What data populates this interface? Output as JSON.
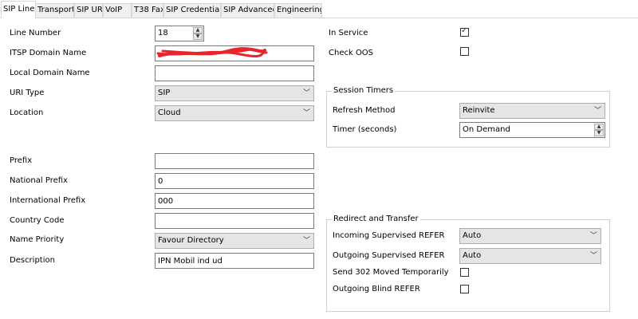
{
  "tabs": [
    {
      "label": "SIP Line",
      "active": true
    },
    {
      "label": "Transport"
    },
    {
      "label": "SIP URI"
    },
    {
      "label": "VoIP"
    },
    {
      "label": "T38 Fax"
    },
    {
      "label": "SIP Credentials"
    },
    {
      "label": "SIP Advanced"
    },
    {
      "label": "Engineering"
    }
  ],
  "left": {
    "line_number": {
      "label": "Line Number",
      "value": "18"
    },
    "itsp_domain": {
      "label": "ITSP Domain Name",
      "value": ""
    },
    "local_domain": {
      "label": "Local Domain Name",
      "value": ""
    },
    "uri_type": {
      "label": "URI Type",
      "value": "SIP"
    },
    "location": {
      "label": "Location",
      "value": "Cloud"
    },
    "prefix": {
      "label": "Prefix",
      "value": ""
    },
    "national_prefix": {
      "label": "National Prefix",
      "value": "0"
    },
    "international_prefix": {
      "label": "International Prefix",
      "value": "000"
    },
    "country_code": {
      "label": "Country Code",
      "value": ""
    },
    "name_priority": {
      "label": "Name Priority",
      "value": "Favour Directory"
    },
    "description": {
      "label": "Description",
      "value": "IPN Mobil ind ud"
    }
  },
  "right": {
    "in_service": {
      "label": "In Service",
      "checked": true
    },
    "check_oos": {
      "label": "Check OOS",
      "checked": false
    }
  },
  "session_timers": {
    "title": "Session Timers",
    "refresh_method": {
      "label": "Refresh  Method",
      "value": "Reinvite"
    },
    "timer": {
      "label": "Timer (seconds)",
      "value": "On Demand"
    }
  },
  "redirect": {
    "title": "Redirect and Transfer",
    "incoming_refer": {
      "label": "Incoming Supervised REFER",
      "value": "Auto"
    },
    "outgoing_refer": {
      "label": "Outgoing Supervised REFER",
      "value": "Auto"
    },
    "send_302": {
      "label": "Send 302 Moved Temporarily",
      "checked": false
    },
    "blind_refer": {
      "label": "Outgoing Blind REFER",
      "checked": false
    }
  },
  "colors": {
    "redaction": "#e8242c",
    "border": "#7a7a7a",
    "select_bg": "#e5e5e5"
  }
}
